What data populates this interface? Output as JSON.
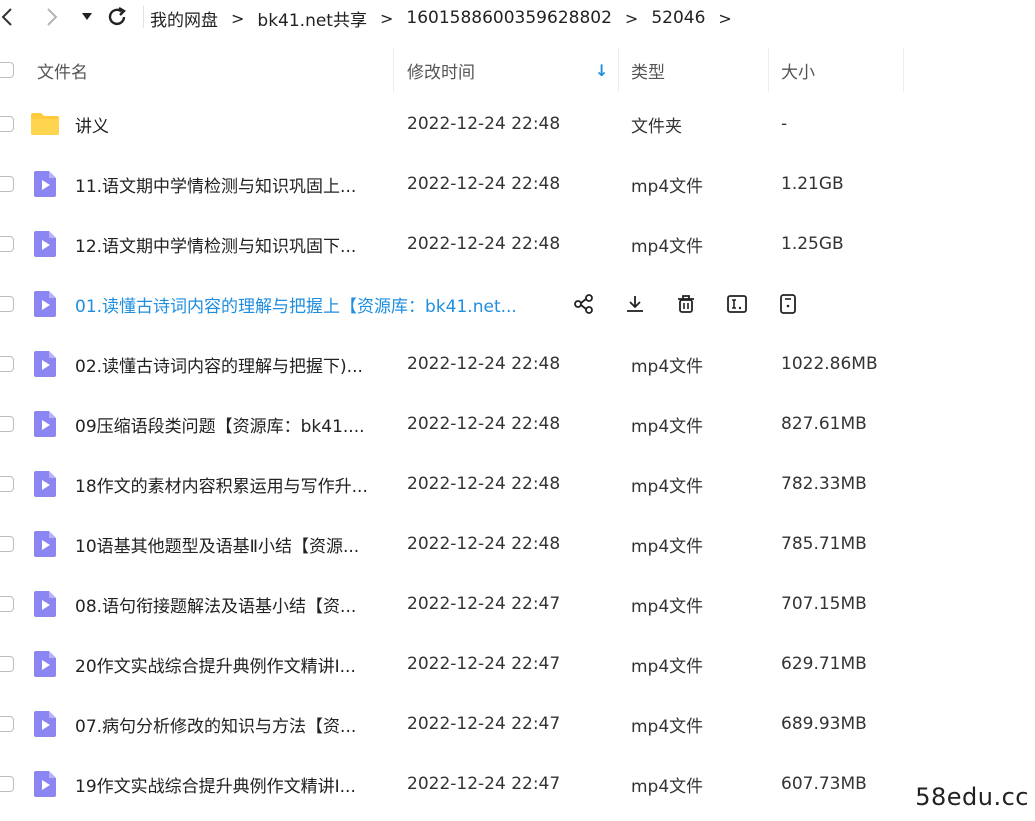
{
  "breadcrumb": [
    "我的网盘",
    "bk41.net共享",
    "1601588600359628802",
    "52046"
  ],
  "breadcrumb_separator": ">",
  "nav_icons": [
    "back-icon",
    "forward-icon",
    "dropdown-icon",
    "refresh-icon"
  ],
  "columns": {
    "name": "文件名",
    "time": "修改时间",
    "type": "类型",
    "size": "大小",
    "sort_indicator": "↓"
  },
  "colors": {
    "folder": "#ffcb3d",
    "video": "#8c86f2",
    "highlight": "#1e8ee0",
    "sort_arrow": "#1e8ee0"
  },
  "files": [
    {
      "icon": "folder-icon",
      "name": "讲义",
      "time": "2022-12-24 22:48",
      "type": "文件夹",
      "size": "-"
    },
    {
      "icon": "video-file-icon",
      "name": "11.语文期中学情检测与知识巩固上...",
      "time": "2022-12-24 22:48",
      "type": "mp4文件",
      "size": "1.21GB"
    },
    {
      "icon": "video-file-icon",
      "name": "12.语文期中学情检测与知识巩固下...",
      "time": "2022-12-24 22:48",
      "type": "mp4文件",
      "size": "1.25GB"
    },
    {
      "icon": "video-file-icon",
      "name": "01.读懂古诗词内容的理解与把握上【资源库：bk41.net...",
      "time": "",
      "type": "",
      "size": "",
      "hovered": true
    },
    {
      "icon": "video-file-icon",
      "name": "02.读懂古诗词内容的理解与把握下)...",
      "time": "2022-12-24 22:48",
      "type": "mp4文件",
      "size": "1022.86MB"
    },
    {
      "icon": "video-file-icon",
      "name": "09压缩语段类问题【资源库：bk41....",
      "time": "2022-12-24 22:48",
      "type": "mp4文件",
      "size": "827.61MB"
    },
    {
      "icon": "video-file-icon",
      "name": "18作文的素材内容积累运用与写作升...",
      "time": "2022-12-24 22:48",
      "type": "mp4文件",
      "size": "782.33MB"
    },
    {
      "icon": "video-file-icon",
      "name": "10语基其他题型及语基Ⅱ小结【资源...",
      "time": "2022-12-24 22:48",
      "type": "mp4文件",
      "size": "785.71MB"
    },
    {
      "icon": "video-file-icon",
      "name": "08.语句衔接题解法及语基小结【资...",
      "time": "2022-12-24 22:47",
      "type": "mp4文件",
      "size": "707.15MB"
    },
    {
      "icon": "video-file-icon",
      "name": "20作文实战综合提升典例作文精讲I...",
      "time": "2022-12-24 22:47",
      "type": "mp4文件",
      "size": "629.71MB"
    },
    {
      "icon": "video-file-icon",
      "name": "07.病句分析修改的知识与方法【资...",
      "time": "2022-12-24 22:47",
      "type": "mp4文件",
      "size": "689.93MB"
    },
    {
      "icon": "video-file-icon",
      "name": "19作文实战综合提升典例作文精讲I...",
      "time": "2022-12-24 22:47",
      "type": "mp4文件",
      "size": "607.73MB"
    }
  ],
  "row_actions": [
    "share-icon",
    "download-icon",
    "delete-icon",
    "rename-icon",
    "more-icon"
  ],
  "watermark": "58edu.cc"
}
